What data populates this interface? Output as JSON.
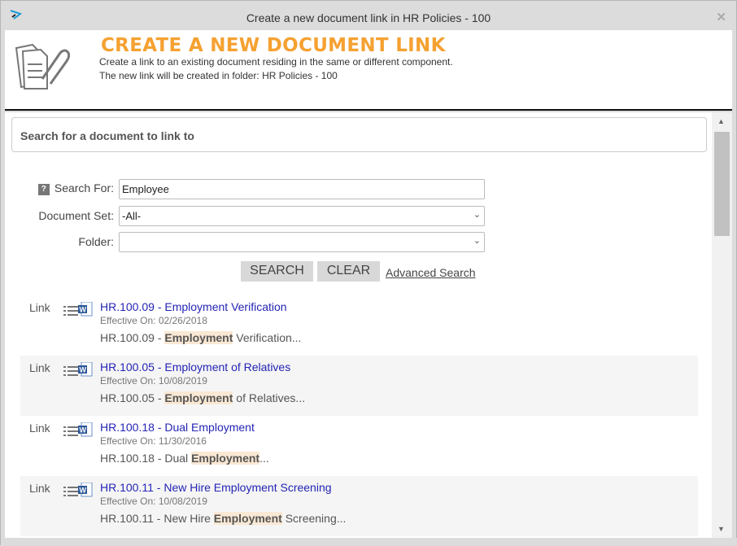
{
  "window": {
    "title": "Create a new document link in HR Policies - 100"
  },
  "header": {
    "title": "CREATE A NEW DOCUMENT LINK",
    "line1": "Create a link to an existing document residing in the same or different component.",
    "line2": "The new link will be created in folder: HR Policies - 100"
  },
  "search": {
    "panel_title": "Search for a document to link to",
    "search_for_label": "Search For:",
    "search_for_value": "Employee",
    "doc_set_label": "Document Set:",
    "doc_set_value": "-All-",
    "folder_label": "Folder:",
    "folder_value": "",
    "search_btn": "SEARCH",
    "clear_btn": "CLEAR",
    "advanced": "Advanced Search"
  },
  "results": [
    {
      "link": "Link",
      "title": "HR.100.09 - Employment Verification",
      "date": "Effective On: 02/26/2018",
      "pre": "HR.100.09 - ",
      "hl": "Employment",
      "post": " Verification..."
    },
    {
      "link": "Link",
      "title": "HR.100.05 - Employment of Relatives",
      "date": "Effective On: 10/08/2019",
      "pre": "HR.100.05 - ",
      "hl": "Employment",
      "post": " of Relatives..."
    },
    {
      "link": "Link",
      "title": "HR.100.18 - Dual Employment",
      "date": "Effective On: 11/30/2016",
      "pre": "HR.100.18 - Dual ",
      "hl": "Employment",
      "post": "..."
    },
    {
      "link": "Link",
      "title": "HR.100.11 - New Hire Employment Screening",
      "date": "Effective On: 10/08/2019",
      "pre": "HR.100.11 - New Hire ",
      "hl": "Employment",
      "post": " Screening..."
    }
  ]
}
